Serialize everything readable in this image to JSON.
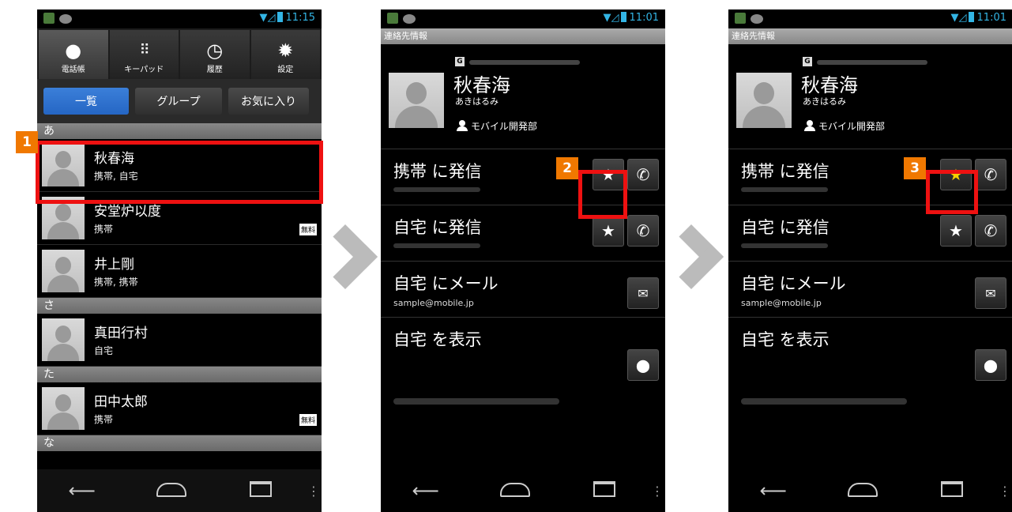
{
  "screen1": {
    "status_time": "11:15",
    "tabs": [
      {
        "label": "電話帳",
        "icon": "person-icon"
      },
      {
        "label": "キーパッド",
        "icon": "keypad-icon"
      },
      {
        "label": "履歴",
        "icon": "clock-icon"
      },
      {
        "label": "設定",
        "icon": "gear-icon"
      }
    ],
    "subtabs": [
      "一覧",
      "グループ",
      "お気に入り"
    ],
    "sections": {
      "a": "あ",
      "sa": "さ",
      "ta": "た",
      "na": "な"
    },
    "contacts": [
      {
        "name": "秋春海",
        "sub": "携帯, 自宅",
        "badge": ""
      },
      {
        "name": "安堂炉以度",
        "sub": "携帯",
        "badge": "無料"
      },
      {
        "name": "井上剛",
        "sub": "携帯, 携帯",
        "badge": ""
      },
      {
        "name": "真田行村",
        "sub": "自宅",
        "badge": ""
      },
      {
        "name": "田中太郎",
        "sub": "携帯",
        "badge": "無料"
      }
    ]
  },
  "detail": {
    "title": "連絡先情報",
    "gmark": "G",
    "name": "秋春海",
    "kana": "あきはるみ",
    "org": "モバイル開発部",
    "rows": [
      {
        "label": "携帯 に発信",
        "sub": ""
      },
      {
        "label": "自宅 に発信",
        "sub": ""
      },
      {
        "label": "自宅 にメール",
        "sub": "sample@mobile.jp"
      },
      {
        "label": "自宅 を表示",
        "sub": ""
      }
    ]
  },
  "screen2": {
    "status_time": "11:01"
  },
  "screen3": {
    "status_time": "11:01"
  },
  "steps": [
    "1",
    "2",
    "3"
  ],
  "colors": {
    "highlight": "#ee1111",
    "step_badge": "#f07800",
    "favorite_star": "#f5d000",
    "active_tab": "#2566c4"
  }
}
